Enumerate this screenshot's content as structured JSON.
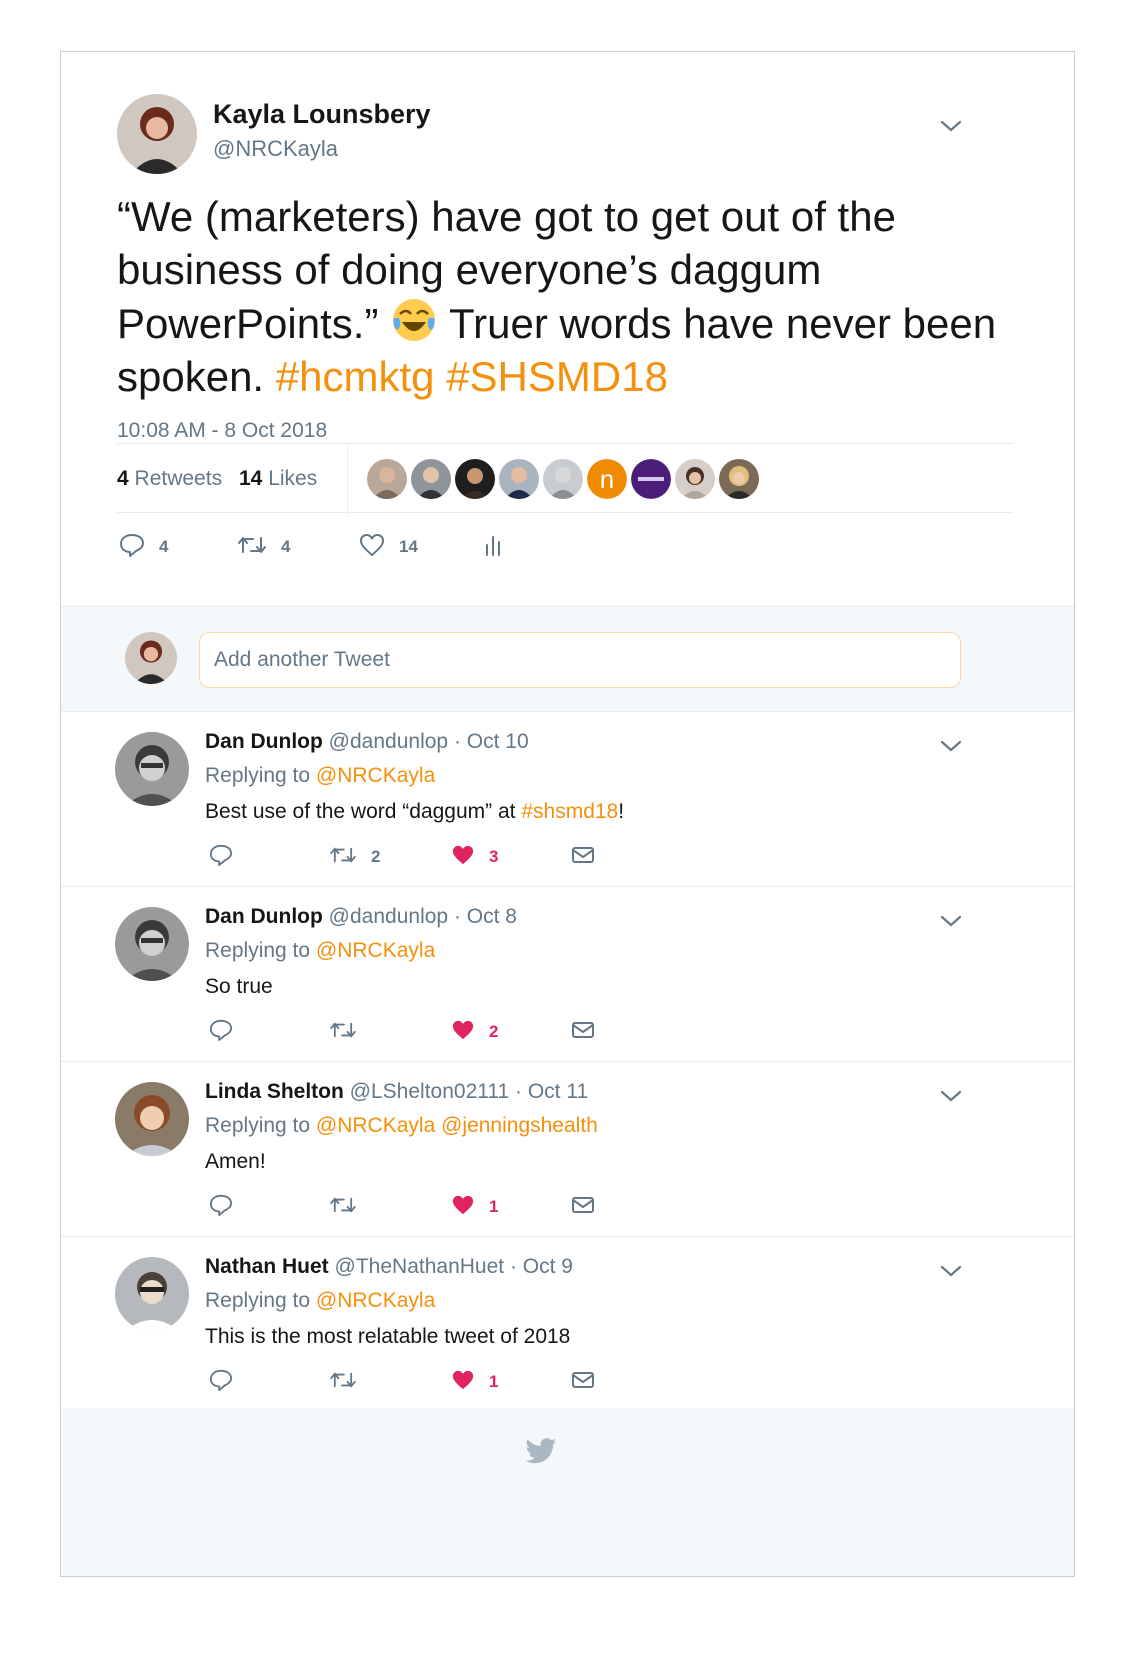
{
  "tweet": {
    "author_name": "Kayla Lounsbery",
    "author_handle": "@NRCKayla",
    "text_part1": "“We (marketers) have got to get out of the business of doing everyone’s daggum PowerPoints.”",
    "emoji_icon": "face-with-tears-of-joy",
    "text_part2": "Truer words have never been spoken.",
    "hashtag1": "#hcmktg",
    "hashtag2": "#SHSMD18",
    "timestamp": "10:08 AM - 8 Oct 2018",
    "retweets_count": "4",
    "retweets_label": "Retweets",
    "likes_count": "14",
    "likes_label": "Likes",
    "reply_count": "4",
    "retweet_count": "4",
    "like_count": "14"
  },
  "compose": {
    "placeholder": "Add another Tweet"
  },
  "replies": [
    {
      "name": "Dan Dunlop",
      "handle": "@dandunlop",
      "date": "· Oct 10",
      "replying_prefix": "Replying to",
      "replying_to": "@NRCKayla",
      "text_before": "Best use of the word “daggum” at",
      "text_tag": "#shsmd18",
      "text_after": "!",
      "retweets": "2",
      "likes": "3"
    },
    {
      "name": "Dan Dunlop",
      "handle": "@dandunlop",
      "date": "· Oct 8",
      "replying_prefix": "Replying to",
      "replying_to": "@NRCKayla",
      "text": "So true",
      "retweets": "",
      "likes": "2"
    },
    {
      "name": "Linda Shelton",
      "handle": "@LShelton02111",
      "date": "· Oct 11",
      "replying_prefix": "Replying to",
      "replying_to": "@NRCKayla @jenningshealth",
      "text": "Amen!",
      "retweets": "",
      "likes": "1"
    },
    {
      "name": "Nathan Huet",
      "handle": "@TheNathanHuet",
      "date": "· Oct 9",
      "replying_prefix": "Replying to",
      "replying_to": "@NRCKayla",
      "text": "This is the most relatable tweet of 2018",
      "retweets": "",
      "likes": "1"
    }
  ],
  "colors": {
    "accent": "#f4900c",
    "like": "#e0245e",
    "muted": "#657786",
    "text": "#14171a"
  }
}
